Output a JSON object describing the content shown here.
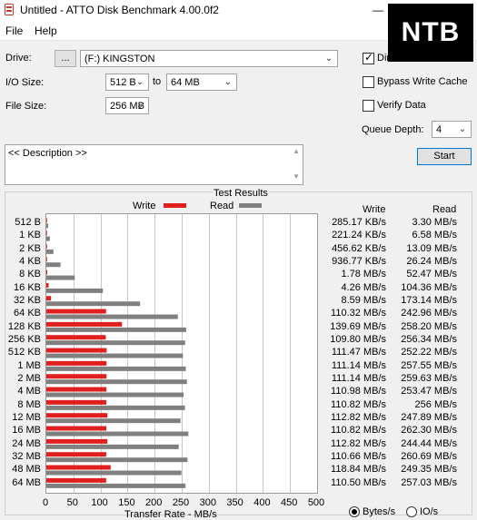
{
  "window": {
    "title": "Untitled - ATTO Disk Benchmark 4.00.0f2",
    "minimize": "—",
    "watermark": "NTB"
  },
  "menu": {
    "file": "File",
    "help": "Help"
  },
  "form": {
    "drive_label": "Drive:",
    "browse_label": "...",
    "drive_value": "(F:) KINGSTON",
    "io_label": "I/O Size:",
    "io_from": "512 B",
    "io_to_label": "to",
    "io_to": "64 MB",
    "file_label": "File Size:",
    "file_value": "256 MB"
  },
  "options": {
    "direct_io_label": "Direct I/O",
    "direct_io_checked": true,
    "bypass_label": "Bypass Write Cache",
    "bypass_checked": false,
    "verify_label": "Verify Data",
    "verify_checked": false,
    "queue_label": "Queue Depth:",
    "queue_value": "4",
    "start_label": "Start"
  },
  "description": {
    "text": "<< Description >>"
  },
  "results": {
    "title": "Test Results",
    "write_label": "Write",
    "read_label": "Read",
    "write_col": "Write",
    "read_col": "Read",
    "xlabel": "Transfer Rate - MB/s",
    "units_bytes": "Bytes/s",
    "units_io": "IO/s",
    "units_selected": "bytes"
  },
  "colors": {
    "write": "#e11f1f",
    "read": "#808080"
  },
  "chart_data": {
    "type": "bar",
    "orientation": "horizontal",
    "title": "Test Results",
    "xlabel": "Transfer Rate - MB/s",
    "xlim": [
      0,
      500
    ],
    "xticks": [
      "0",
      "50",
      "100",
      "150",
      "200",
      "250",
      "300",
      "350",
      "400",
      "450",
      "500"
    ],
    "grid": true,
    "legend": "top",
    "categories": [
      "512 B",
      "1 KB",
      "2 KB",
      "4 KB",
      "8 KB",
      "16 KB",
      "32 KB",
      "64 KB",
      "128 KB",
      "256 KB",
      "512 KB",
      "1 MB",
      "2 MB",
      "4 MB",
      "8 MB",
      "12 MB",
      "16 MB",
      "24 MB",
      "32 MB",
      "48 MB",
      "64 MB"
    ],
    "series": [
      {
        "name": "Write",
        "values": [
          0.285,
          0.221,
          0.457,
          0.937,
          1.78,
          4.26,
          8.59,
          110.32,
          139.69,
          109.8,
          111.47,
          111.14,
          111.14,
          110.98,
          110.82,
          112.82,
          110.82,
          112.82,
          110.66,
          118.84,
          110.5
        ]
      },
      {
        "name": "Read",
        "values": [
          3.3,
          6.58,
          13.09,
          26.24,
          52.47,
          104.36,
          173.14,
          242.96,
          258.2,
          256.34,
          252.22,
          257.55,
          259.63,
          253.47,
          256,
          247.89,
          262.3,
          244.44,
          260.69,
          249.35,
          257.03
        ]
      }
    ],
    "write_text": [
      "285.17 KB/s",
      "221.24 KB/s",
      "456.62 KB/s",
      "936.77 KB/s",
      "1.78 MB/s",
      "4.26 MB/s",
      "8.59 MB/s",
      "110.32 MB/s",
      "139.69 MB/s",
      "109.80 MB/s",
      "111.47 MB/s",
      "111.14 MB/s",
      "111.14 MB/s",
      "110.98 MB/s",
      "110.82 MB/s",
      "112.82 MB/s",
      "110.82 MB/s",
      "112.82 MB/s",
      "110.66 MB/s",
      "118.84 MB/s",
      "110.50 MB/s"
    ],
    "read_text": [
      "3.30 MB/s",
      "6.58 MB/s",
      "13.09 MB/s",
      "26.24 MB/s",
      "52.47 MB/s",
      "104.36 MB/s",
      "173.14 MB/s",
      "242.96 MB/s",
      "258.20 MB/s",
      "256.34 MB/s",
      "252.22 MB/s",
      "257.55 MB/s",
      "259.63 MB/s",
      "253.47 MB/s",
      "256 MB/s",
      "247.89 MB/s",
      "262.30 MB/s",
      "244.44 MB/s",
      "260.69 MB/s",
      "249.35 MB/s",
      "257.03 MB/s"
    ]
  }
}
